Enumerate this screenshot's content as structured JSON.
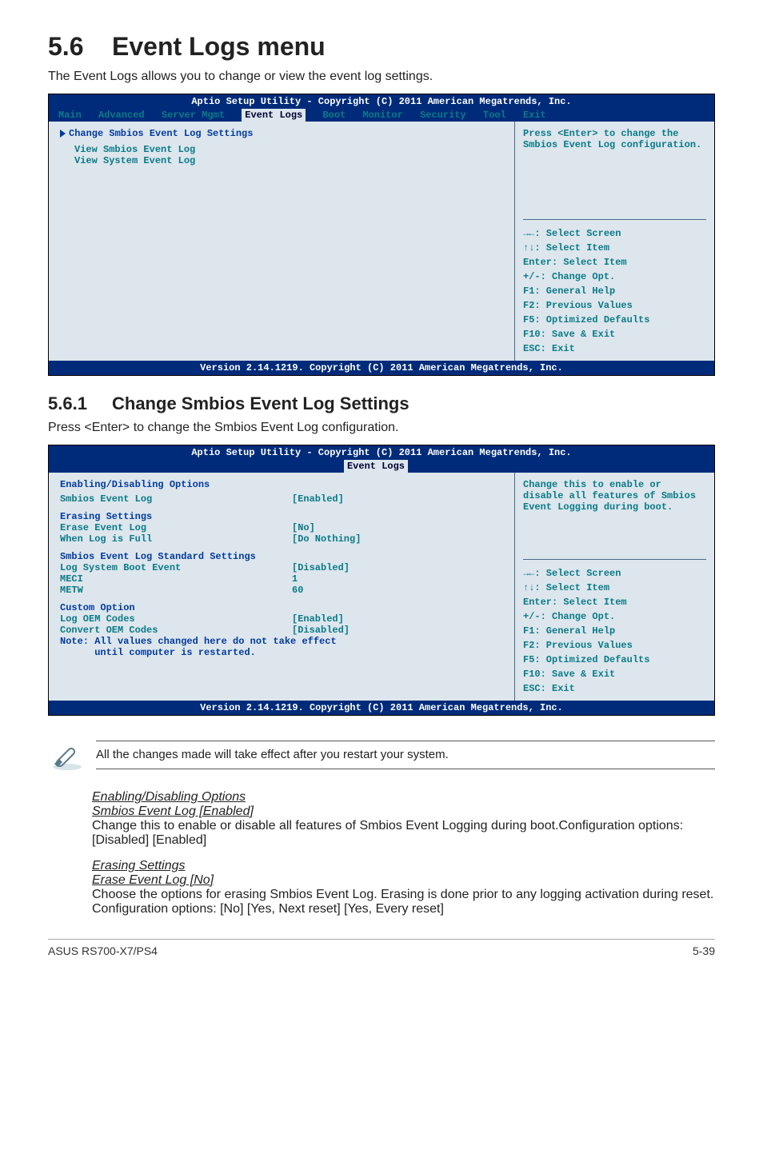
{
  "section": {
    "number": "5.6",
    "title": "Event Logs menu"
  },
  "intro": "The Event Logs allows you to change or view the event log settings.",
  "bios1": {
    "title": "Aptio Setup Utility - Copyright (C) 2011 American Megatrends, Inc.",
    "tabs": [
      "Main",
      "Advanced",
      "Server Mgmt",
      "Event Logs",
      "Boot",
      "Monitor",
      "Security",
      "Tool",
      "Exit"
    ],
    "active_tab": "Event Logs",
    "left": {
      "line1": "Change Smbios Event Log Settings",
      "line2": "View Smbios Event Log",
      "line3": "View System Event Log"
    },
    "right_help": "Press <Enter> to change the Smbios Event Log configuration.",
    "keys": {
      "k1": "→←: Select Screen",
      "k2": "↑↓:  Select Item",
      "k3": "Enter: Select Item",
      "k4": "+/-: Change Opt.",
      "k5": "F1: General Help",
      "k6": "F2: Previous Values",
      "k7": "F5: Optimized Defaults",
      "k8": "F10: Save & Exit",
      "k9": "ESC: Exit"
    },
    "footer": "Version 2.14.1219. Copyright (C) 2011 American Megatrends, Inc."
  },
  "subsection": {
    "number": "5.6.1",
    "title": "Change Smbios Event Log Settings"
  },
  "sub_intro": "Press <Enter> to change the Smbios Event Log configuration.",
  "bios2": {
    "title": "Aptio Setup Utility - Copyright (C) 2011 American Megatrends, Inc.",
    "tab": "Event Logs",
    "rows": {
      "h1": "Enabling/Disabling Options",
      "r1l": "Smbios Event Log",
      "r1v": "[Enabled]",
      "h2": "Erasing Settings",
      "r2l": "Erase Event Log",
      "r2v": "[No]",
      "r3l": "When Log is Full",
      "r3v": "[Do Nothing]",
      "h3": "Smbios Event Log Standard Settings",
      "r4l": "Log System Boot Event",
      "r4v": "[Disabled]",
      "r5l": "MECI",
      "r5v": "1",
      "r6l": "METW",
      "r6v": "60",
      "h4": "Custom Option",
      "r7l": "Log OEM Codes",
      "r7v": "[Enabled]",
      "r8l": "Convert OEM Codes",
      "r8v": "[Disabled]",
      "note1": "Note: All values changed here do not take effect",
      "note2": "      until computer is restarted."
    },
    "right_help": "Change this to enable or disable all features of Smbios Event Logging during boot.",
    "footer": "Version 2.14.1219. Copyright (C) 2011 American Megatrends, Inc."
  },
  "note": "All the changes made will take effect after you restart your system.",
  "opt1": {
    "h1": "Enabling/Disabling Options",
    "h2": "Smbios Event Log [Enabled]",
    "p": "Change this to enable or disable all features of Smbios Event Logging during boot.Configuration options: [Disabled] [Enabled]"
  },
  "opt2": {
    "h1": "Erasing Settings",
    "h2": "Erase Event Log [No]",
    "p1": "Choose the options for erasing Smbios Event Log. Erasing is done prior to any logging activation during reset.",
    "p2": "Configuration options: [No] [Yes, Next reset] [Yes, Every reset]"
  },
  "footer": {
    "product": "ASUS RS700-X7/PS4",
    "page": "5-39"
  }
}
